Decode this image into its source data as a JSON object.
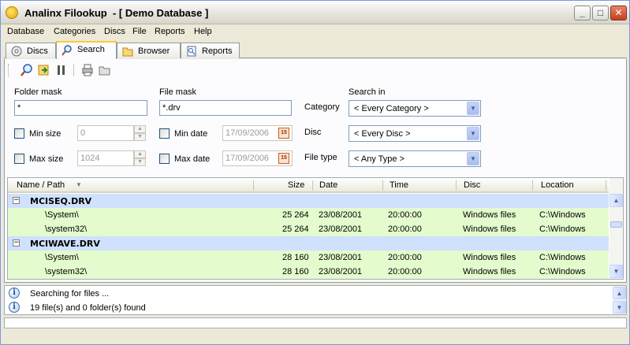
{
  "window": {
    "title": "Analinx Filookup  - [ Demo Database ]",
    "min_btn": "_",
    "max_btn": "□",
    "close_btn": "✕"
  },
  "menu": [
    "Database",
    "Categories",
    "Discs",
    "File",
    "Reports",
    "Help"
  ],
  "tabs": [
    {
      "label": "Discs",
      "icon": "disc-icon"
    },
    {
      "label": "Search",
      "icon": "magnifier-icon"
    },
    {
      "label": "Browser",
      "icon": "folder-icon"
    },
    {
      "label": "Reports",
      "icon": "report-icon"
    }
  ],
  "search_form": {
    "folder_mask_label": "Folder mask",
    "folder_mask_value": "*",
    "file_mask_label": "File mask",
    "file_mask_value": "*.drv",
    "search_in_label": "Search in",
    "category_label": "Category",
    "category_value": "< Every Category >",
    "disc_label": "Disc",
    "disc_value": "< Every Disc >",
    "file_type_label": "File type",
    "file_type_value": "< Any Type >",
    "min_size_label": "Min size",
    "min_size_value": "0",
    "max_size_label": "Max size",
    "max_size_value": "1024",
    "min_date_label": "Min date",
    "min_date_value": "17/09/2006",
    "max_date_label": "Max date",
    "max_date_value": "17/09/2006",
    "calendar_glyph": "15"
  },
  "results": {
    "columns": [
      "Name / Path",
      "Size",
      "Date",
      "Time",
      "Disc",
      "Location"
    ],
    "groups": [
      {
        "name": "MCISEQ.DRV",
        "rows": [
          {
            "path": "\\System\\",
            "size": "25 264",
            "date": "23/08/2001",
            "time": "20:00:00",
            "disc": "Windows files",
            "location": "C:\\Windows"
          },
          {
            "path": "\\system32\\",
            "size": "25 264",
            "date": "23/08/2001",
            "time": "20:00:00",
            "disc": "Windows files",
            "location": "C:\\Windows"
          }
        ]
      },
      {
        "name": "MCIWAVE.DRV",
        "rows": [
          {
            "path": "\\System\\",
            "size": "28 160",
            "date": "23/08/2001",
            "time": "20:00:00",
            "disc": "Windows files",
            "location": "C:\\Windows"
          },
          {
            "path": "\\system32\\",
            "size": "28 160",
            "date": "23/08/2001",
            "time": "20:00:00",
            "disc": "Windows files",
            "location": "C:\\Windows"
          }
        ]
      }
    ],
    "expander_glyph": "−"
  },
  "log": {
    "lines": [
      "Searching for files ...",
      "19 file(s) and 0 folder(s) found"
    ],
    "info_glyph": "i"
  },
  "colors": {
    "group_row": "#cfe1fd",
    "item_row": "#e3fbcd",
    "tab_accent": "#ffc83c"
  }
}
